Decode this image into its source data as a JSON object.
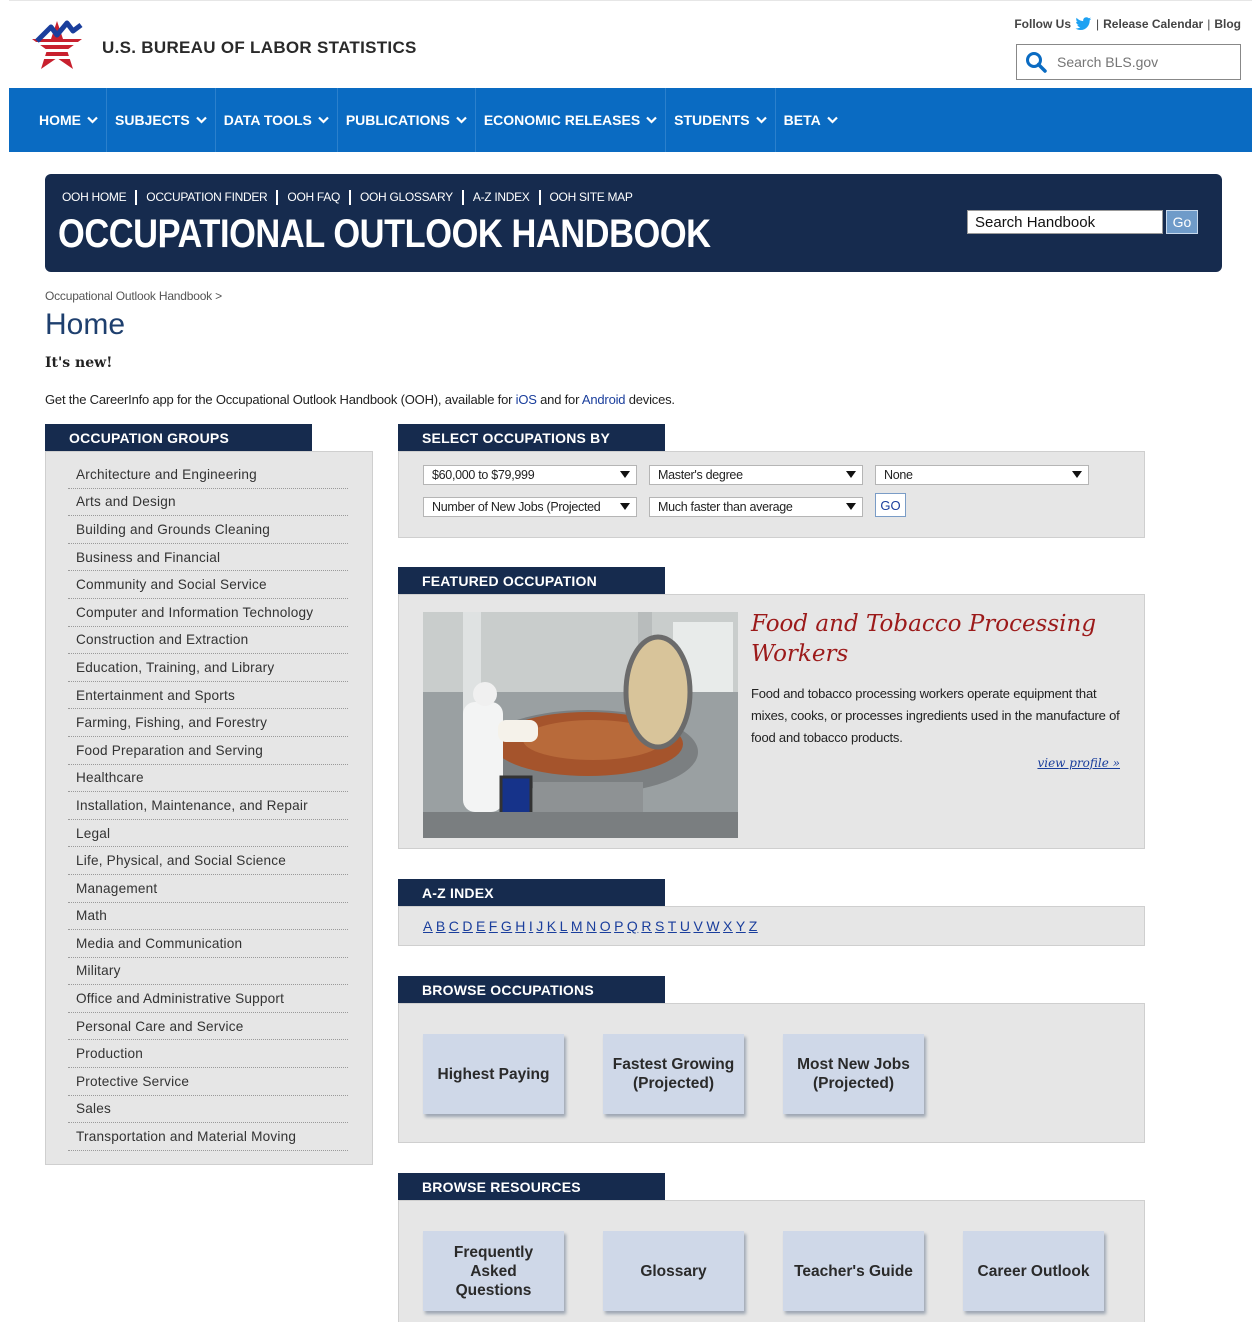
{
  "header": {
    "agency_name": "U.S. BUREAU OF LABOR STATISTICS",
    "follow_us": "Follow Us",
    "release_calendar": "Release Calendar",
    "blog": "Blog",
    "search_placeholder": "Search BLS.gov"
  },
  "nav": {
    "items": [
      "HOME",
      "SUBJECTS",
      "DATA TOOLS",
      "PUBLICATIONS",
      "ECONOMIC RELEASES",
      "STUDENTS",
      "BETA"
    ]
  },
  "ooh": {
    "links": [
      "OOH HOME",
      "OCCUPATION FINDER",
      "OOH FAQ",
      "OOH GLOSSARY",
      "A-Z INDEX",
      "OOH SITE MAP"
    ],
    "title": "OCCUPATIONAL OUTLOOK HANDBOOK",
    "search_value": "Search Handbook",
    "go_label": "Go"
  },
  "page": {
    "breadcrumb": "Occupational Outlook Handbook >",
    "title": "Home",
    "new_label": "It's new!",
    "intro_prefix": "Get the CareerInfo app for the Occupational Outlook Handbook (OOH), available for ",
    "ios_link": "iOS",
    "intro_mid": " and for ",
    "android_link": "Android",
    "intro_suffix": " devices."
  },
  "groups": {
    "heading": "OCCUPATION GROUPS",
    "items": [
      "Architecture and Engineering",
      "Arts and Design",
      "Building and Grounds Cleaning",
      "Business and Financial",
      "Community and Social Service",
      "Computer and Information Technology",
      "Construction and Extraction",
      "Education, Training, and Library",
      "Entertainment and Sports",
      "Farming, Fishing, and Forestry",
      "Food Preparation and Serving",
      "Healthcare",
      "Installation, Maintenance, and Repair",
      "Legal",
      "Life, Physical, and Social Science",
      "Management",
      "Math",
      "Media and Communication",
      "Military",
      "Office and Administrative Support",
      "Personal Care and Service",
      "Production",
      "Protective Service",
      "Sales",
      "Transportation and Material Moving"
    ]
  },
  "select_by": {
    "heading": "SELECT OCCUPATIONS BY",
    "pay": "$60,000 to $79,999",
    "education": "Master's degree",
    "training": "None",
    "sort": "Number of New Jobs (Projected",
    "growth": "Much faster than average",
    "go_label": "GO"
  },
  "featured": {
    "heading": "FEATURED OCCUPATION",
    "title": "Food and Tobacco Processing Workers",
    "description": "Food and tobacco processing workers operate equipment that mixes, cooks, or processes ingredients used in the manufacture of food and tobacco products.",
    "link": "view profile »"
  },
  "az": {
    "heading": "A-Z INDEX",
    "letters": [
      "A",
      "B",
      "C",
      "D",
      "E",
      "F",
      "G",
      "H",
      "I",
      "J",
      "K",
      "L",
      "M",
      "N",
      "O",
      "P",
      "Q",
      "R",
      "S",
      "T",
      "U",
      "V",
      "W",
      "X",
      "Y",
      "Z"
    ]
  },
  "browse_occupations": {
    "heading": "BROWSE OCCUPATIONS",
    "tiles": [
      "Highest Paying",
      "Fastest Growing (Projected)",
      "Most New Jobs (Projected)"
    ]
  },
  "browse_resources": {
    "heading": "BROWSE RESOURCES",
    "tiles": [
      "Frequently Asked Questions",
      "Glossary",
      "Teacher's Guide",
      "Career Outlook"
    ]
  },
  "colors": {
    "nav_blue": "#0a6bc2",
    "navy": "#162b4e",
    "featured_title_red": "#9c1a1a",
    "link_blue": "#1a3e9c"
  }
}
